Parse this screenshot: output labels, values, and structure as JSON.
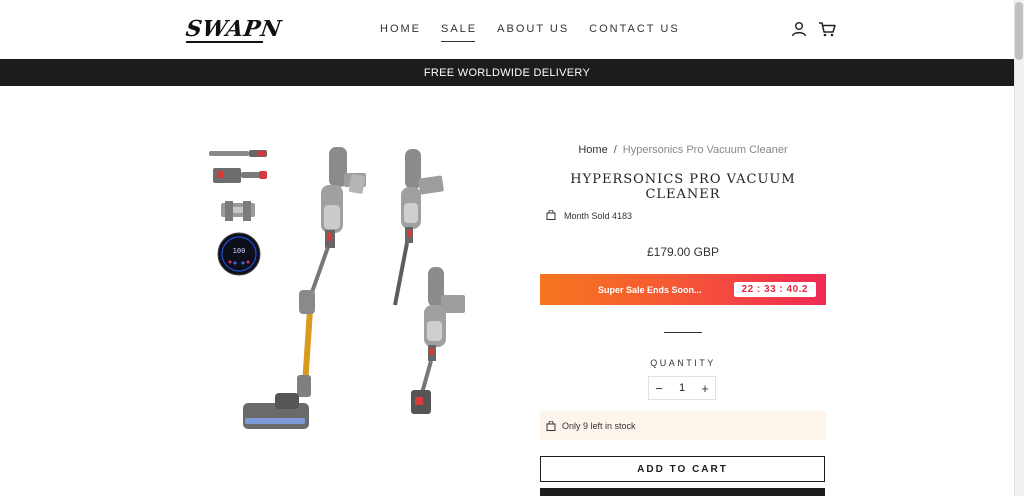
{
  "header": {
    "logo": "SWAPN",
    "nav": [
      {
        "label": "HOME",
        "active": false
      },
      {
        "label": "SALE",
        "active": true
      },
      {
        "label": "ABOUT US",
        "active": false
      },
      {
        "label": "CONTACT US",
        "active": false
      }
    ],
    "icons": [
      "user-icon",
      "cart-icon"
    ]
  },
  "announcement": "FREE WORLDWIDE DELIVERY",
  "breadcrumb": {
    "home": "Home",
    "separator": "/",
    "current": "Hypersonics Pro Vacuum Cleaner"
  },
  "product": {
    "title": "HYPERSONICS PRO VACUUM CLEANER",
    "sold": "Month Sold 4183",
    "price": "£179.00 GBP",
    "sale_text": "Super Sale Ends Soon...",
    "timer": "22 : 33 : 40.2",
    "quantity_label": "QUANTITY",
    "quantity_value": "1",
    "minus": "−",
    "plus": "+",
    "stock_text": "Only 9 left in stock",
    "add_to_cart": "ADD TO CART"
  },
  "thumbnails": [
    {
      "name": "thumb-extension-tool"
    },
    {
      "name": "thumb-brush-tools"
    },
    {
      "name": "thumb-wall-mount"
    },
    {
      "name": "thumb-display-screen",
      "display_text": "100"
    }
  ],
  "colors": {
    "accent_dark": "#1c1d1d",
    "sale_start": "#f6761f",
    "sale_end": "#ef2a55",
    "timer_text": "#e8283f",
    "stock_bg": "#fdf4ec",
    "vacuum_gold": "#d99a1e",
    "vacuum_red": "#d63a3a"
  }
}
